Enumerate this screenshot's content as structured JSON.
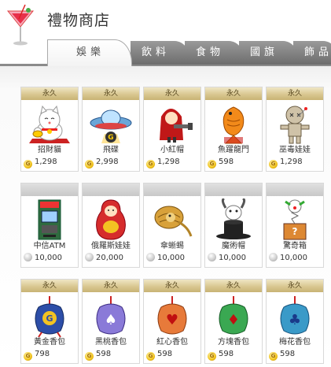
{
  "header": {
    "title": "禮物商店",
    "logo_icon": "cocktail-icon"
  },
  "tabs": [
    {
      "label": "娛樂",
      "active": true
    },
    {
      "label": "飲料",
      "active": false
    },
    {
      "label": "食物",
      "active": false
    },
    {
      "label": "國旗",
      "active": false
    },
    {
      "label": "飾品",
      "active": false
    }
  ],
  "items": [
    {
      "band": "永久",
      "band_style": "gold",
      "name": "招財貓",
      "price": "1,298",
      "coin": "gold",
      "icon": "lucky-cat-icon"
    },
    {
      "band": "永久",
      "band_style": "gold",
      "name": "飛碟",
      "price": "2,998",
      "coin": "gold",
      "icon": "ufo-icon"
    },
    {
      "band": "永久",
      "band_style": "gold",
      "name": "小紅帽",
      "price": "1,298",
      "coin": "gold",
      "icon": "red-hood-icon"
    },
    {
      "band": "永久",
      "band_style": "gold",
      "name": "魚躍龍門",
      "price": "598",
      "coin": "gold",
      "icon": "koi-fish-icon"
    },
    {
      "band": "永久",
      "band_style": "gold",
      "name": "巫毒娃娃",
      "price": "1,298",
      "coin": "gold",
      "icon": "voodoo-doll-icon"
    },
    {
      "band": "",
      "band_style": "gray",
      "name": "中信ATM",
      "price": "10,000",
      "coin": "silver",
      "icon": "atm-icon"
    },
    {
      "band": "",
      "band_style": "gray",
      "name": "俄羅斯娃娃",
      "price": "20,000",
      "coin": "silver",
      "icon": "matryoshka-icon"
    },
    {
      "band": "",
      "band_style": "gray",
      "name": "傘蜥蜴",
      "price": "10,000",
      "coin": "silver",
      "icon": "frilled-lizard-icon"
    },
    {
      "band": "",
      "band_style": "gray",
      "name": "魔術帽",
      "price": "10,000",
      "coin": "silver",
      "icon": "magic-hat-icon"
    },
    {
      "band": "",
      "band_style": "gray",
      "name": "驚奇箱",
      "price": "10,000",
      "coin": "silver",
      "icon": "jack-in-the-box-icon"
    },
    {
      "band": "永久",
      "band_style": "gold",
      "name": "黃金香包",
      "price": "798",
      "coin": "gold",
      "icon": "gold-sachet-icon"
    },
    {
      "band": "永久",
      "band_style": "gold",
      "name": "黑桃香包",
      "price": "598",
      "coin": "gold",
      "icon": "spade-sachet-icon"
    },
    {
      "band": "永久",
      "band_style": "gold",
      "name": "紅心香包",
      "price": "598",
      "coin": "gold",
      "icon": "heart-sachet-icon"
    },
    {
      "band": "永久",
      "band_style": "gold",
      "name": "方塊香包",
      "price": "598",
      "coin": "gold",
      "icon": "diamond-sachet-icon"
    },
    {
      "band": "永久",
      "band_style": "gold",
      "name": "梅花香包",
      "price": "598",
      "coin": "gold",
      "icon": "club-sachet-icon"
    }
  ]
}
